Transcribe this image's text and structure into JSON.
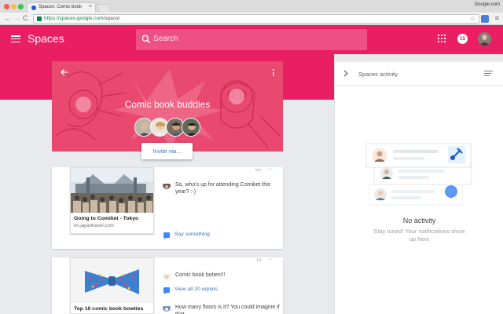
{
  "browser": {
    "tab_title": "Spaces: Comic book",
    "tab_close": "×",
    "profile_label": "Google.com",
    "url_host": "https://spaces.google.com",
    "url_path": "/space/"
  },
  "appbar": {
    "title": "Spaces",
    "search_placeholder": "Search",
    "notification_count": "15",
    "color": "#e91e63"
  },
  "space": {
    "title": "Comic book buddies",
    "invite_label": "Invite via..."
  },
  "posts": [
    {
      "time": "1m",
      "more": "···",
      "link_title": "Going to Comiket - Tokyo",
      "link_domain": "en.japantravel.com",
      "message": "So, who's up for attending Comiket this year? :-)",
      "action_label": "Say something"
    },
    {
      "time": "1d",
      "more": "···",
      "link_title": "Top 10 comic book bowties",
      "message": "Comic book boties!!!",
      "action_label": "View all 20 replies",
      "reply": "How many floors is it? You could imagine if that"
    }
  ],
  "panel": {
    "title": "Spaces activity",
    "empty_title": "No activity",
    "empty_subtitle": "Stay tuned! Your notifications show up here"
  },
  "icons": {
    "back": "arrow-back",
    "menu": "hamburger",
    "search": "magnifier",
    "apps": "grid",
    "chevron": "chevron-right",
    "filter": "filter-lines",
    "chat": "chat-bubble"
  }
}
